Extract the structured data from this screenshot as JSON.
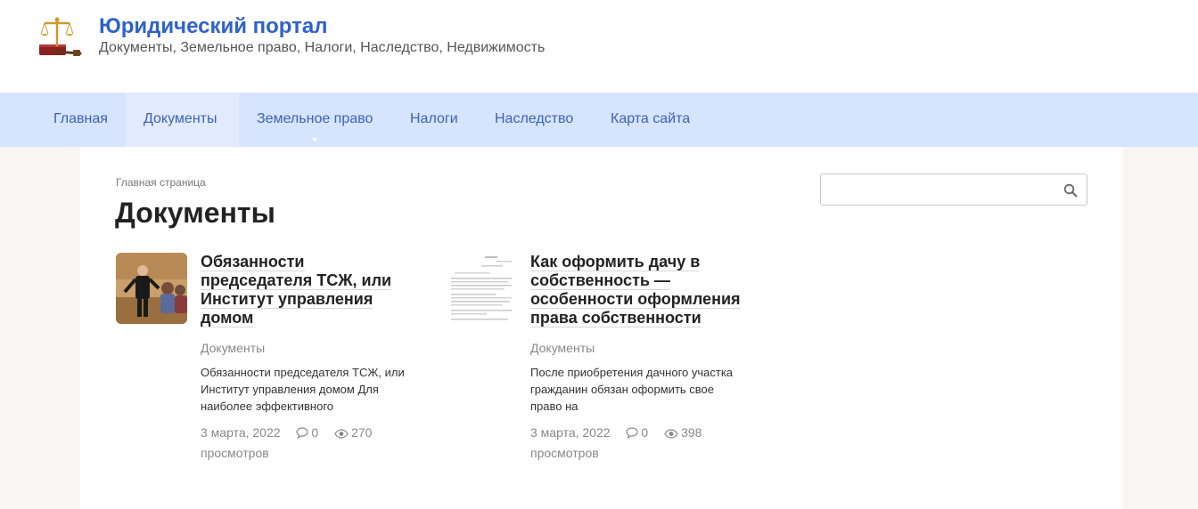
{
  "site": {
    "title": "Юридический портал",
    "description": "Документы, Земельное право, Налоги, Наследство, Недвижимость"
  },
  "nav": {
    "items": [
      {
        "label": "Главная"
      },
      {
        "label": "Документы"
      },
      {
        "label": "Земельное право"
      },
      {
        "label": "Налоги"
      },
      {
        "label": "Наследство"
      },
      {
        "label": "Карта сайта"
      }
    ],
    "active": "Документы"
  },
  "breadcrumb": "Главная страница",
  "page_title": "Документы",
  "search": {
    "placeholder": "",
    "icon": "search-icon"
  },
  "posts": [
    {
      "title": "Обязанности председателя ТСЖ, или Институт управления домом",
      "category": "Документы",
      "excerpt": "Обязанности председателя ТСЖ, или Институт управления домом Для наиболее эффективного",
      "date": "3 марта, 2022",
      "comments": "0",
      "views": "270",
      "views_label": "просмотров"
    },
    {
      "title": "Как оформить дачу в собственность — особенности оформления права собственности",
      "category": "Документы",
      "excerpt": "После приобретения дачного участка гражданин обязан оформить свое право на",
      "date": "3 марта, 2022",
      "comments": "0",
      "views": "398",
      "views_label": "просмотров"
    }
  ],
  "colors": {
    "brand": "#2f62c8",
    "nav_bg": "#d7e4fd",
    "nav_text": "#3a63b8",
    "page_bg": "#f7f6f3"
  }
}
